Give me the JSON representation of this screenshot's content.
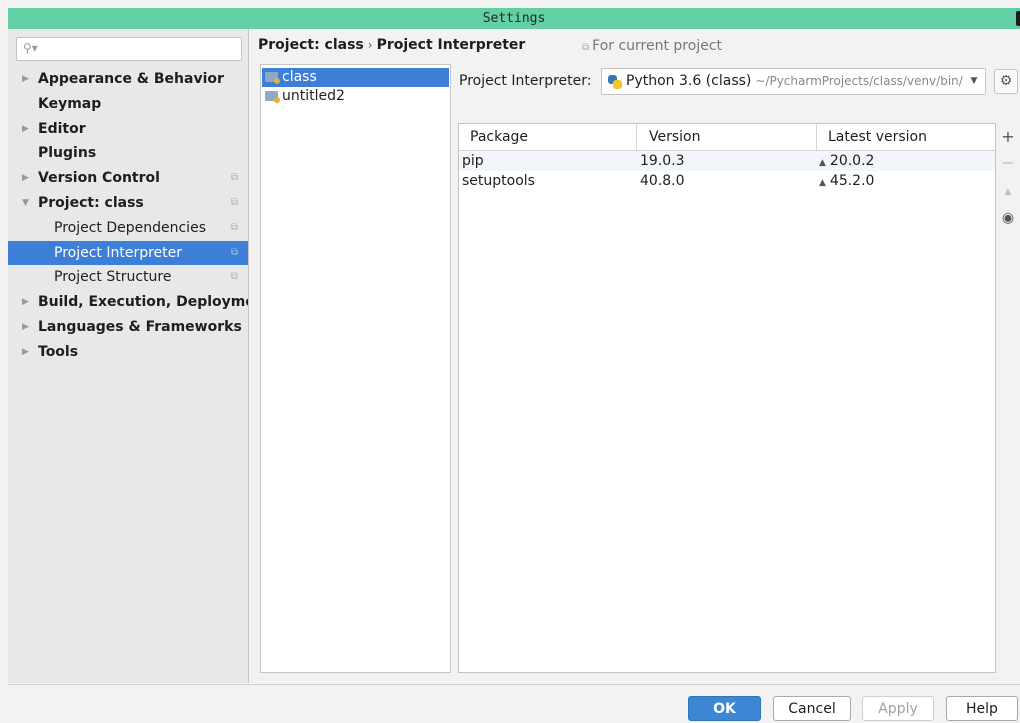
{
  "window": {
    "title": "Settings"
  },
  "search": {
    "placeholder": "",
    "value": ""
  },
  "sidebar": {
    "items": [
      {
        "label": "Appearance & Behavior"
      },
      {
        "label": "Keymap"
      },
      {
        "label": "Editor"
      },
      {
        "label": "Plugins"
      },
      {
        "label": "Version Control"
      },
      {
        "label": "Project: class"
      },
      {
        "label": "Project Dependencies"
      },
      {
        "label": "Project Interpreter"
      },
      {
        "label": "Project Structure"
      },
      {
        "label": "Build, Execution, Deployment"
      },
      {
        "label": "Languages & Frameworks"
      },
      {
        "label": "Tools"
      }
    ]
  },
  "breadcrumb": {
    "parent": "Project: class",
    "separator": "›",
    "current": "Project Interpreter"
  },
  "scope_hint": "For current project",
  "projects": [
    {
      "name": "class",
      "selected": true
    },
    {
      "name": "untitled2",
      "selected": false
    }
  ],
  "interpreter": {
    "label": "Project Interpreter:",
    "name": "Python 3.6 (class)",
    "path": "~/PycharmProjects/class/venv/bin/python"
  },
  "packages": {
    "headers": {
      "package": "Package",
      "version": "Version",
      "latest": "Latest version"
    },
    "rows": [
      {
        "package": "pip",
        "version": "19.0.3",
        "latest": "20.0.2"
      },
      {
        "package": "setuptools",
        "version": "40.8.0",
        "latest": "45.2.0"
      }
    ]
  },
  "tools": {
    "add": "+",
    "remove": "−"
  },
  "buttons": {
    "ok": "OK",
    "cancel": "Cancel",
    "apply": "Apply",
    "help": "Help"
  },
  "colors": {
    "accent": "#3d7fd6",
    "title_bar": "#63cfa4"
  }
}
